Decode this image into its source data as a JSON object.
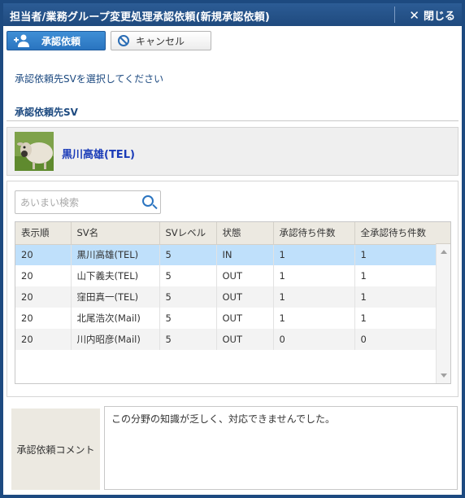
{
  "window": {
    "title": "担当者/業務グループ変更処理承認依頼(新規承認依頼)",
    "close_label": "閉じる"
  },
  "toolbar": {
    "approve_label": "承認依頼",
    "cancel_label": "キャンセル"
  },
  "instruction": "承認依頼先SVを選択してください",
  "selected_sv": {
    "section_title": "承認依頼先SV",
    "name": "黒川高雄(TEL)"
  },
  "search": {
    "placeholder": "あいまい検索",
    "value": ""
  },
  "grid": {
    "columns": [
      "表示順",
      "SV名",
      "SVレベル",
      "状態",
      "承認待ち件数",
      "全承認待ち件数"
    ],
    "rows": [
      [
        "20",
        "黒川高雄(TEL)",
        "5",
        "IN",
        "1",
        "1"
      ],
      [
        "20",
        "山下義夫(TEL)",
        "5",
        "OUT",
        "1",
        "1"
      ],
      [
        "20",
        "窪田真一(TEL)",
        "5",
        "OUT",
        "1",
        "1"
      ],
      [
        "20",
        "北尾浩次(Mail)",
        "5",
        "OUT",
        "1",
        "1"
      ],
      [
        "20",
        "川内昭彦(Mail)",
        "5",
        "OUT",
        "0",
        "0"
      ]
    ],
    "selected_row_index": 0
  },
  "comment": {
    "label": "承認依頼コメント",
    "value": "この分野の知識が乏しく、対応できませんでした。"
  },
  "colors": {
    "title_bar": "#1f4a7e",
    "primary_button": "#2a74c0",
    "selected_row": "#bfe0fb",
    "sv_name": "#1a3bb8"
  },
  "icons": {
    "approve": "user-add-icon",
    "cancel": "prohibited-icon",
    "close": "close-icon",
    "search": "search-icon"
  }
}
